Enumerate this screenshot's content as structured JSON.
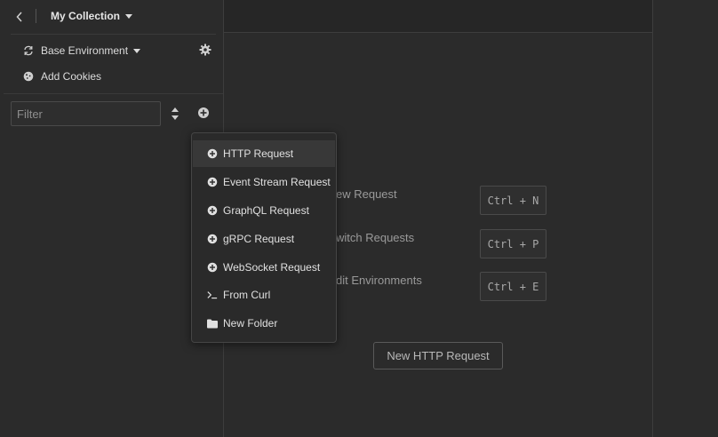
{
  "sidebar": {
    "collection_title": "My Collection",
    "environment_label": "Base Environment",
    "cookies_label": "Add Cookies",
    "filter_placeholder": "Filter"
  },
  "dropdown": {
    "items": [
      {
        "label": "HTTP Request",
        "icon": "plus-circle-icon"
      },
      {
        "label": "Event Stream Request",
        "icon": "plus-circle-icon"
      },
      {
        "label": "GraphQL Request",
        "icon": "plus-circle-icon"
      },
      {
        "label": "gRPC Request",
        "icon": "plus-circle-icon"
      },
      {
        "label": "WebSocket Request",
        "icon": "plus-circle-icon"
      },
      {
        "label": "From Curl",
        "icon": "terminal-icon"
      },
      {
        "label": "New Folder",
        "icon": "folder-icon"
      }
    ]
  },
  "shortcuts": [
    {
      "label": "ew Request",
      "keys": "Ctrl + N"
    },
    {
      "label": "witch Requests",
      "keys": "Ctrl + P"
    },
    {
      "label": "dit Environments",
      "keys": "Ctrl + E"
    }
  ],
  "main": {
    "new_http_button": "New HTTP Request"
  },
  "colors": {
    "background": "#2b2b2b",
    "header": "#262626",
    "border": "#3d3d3d",
    "text": "#dcdcdc",
    "muted_text": "#9a9a9a"
  }
}
